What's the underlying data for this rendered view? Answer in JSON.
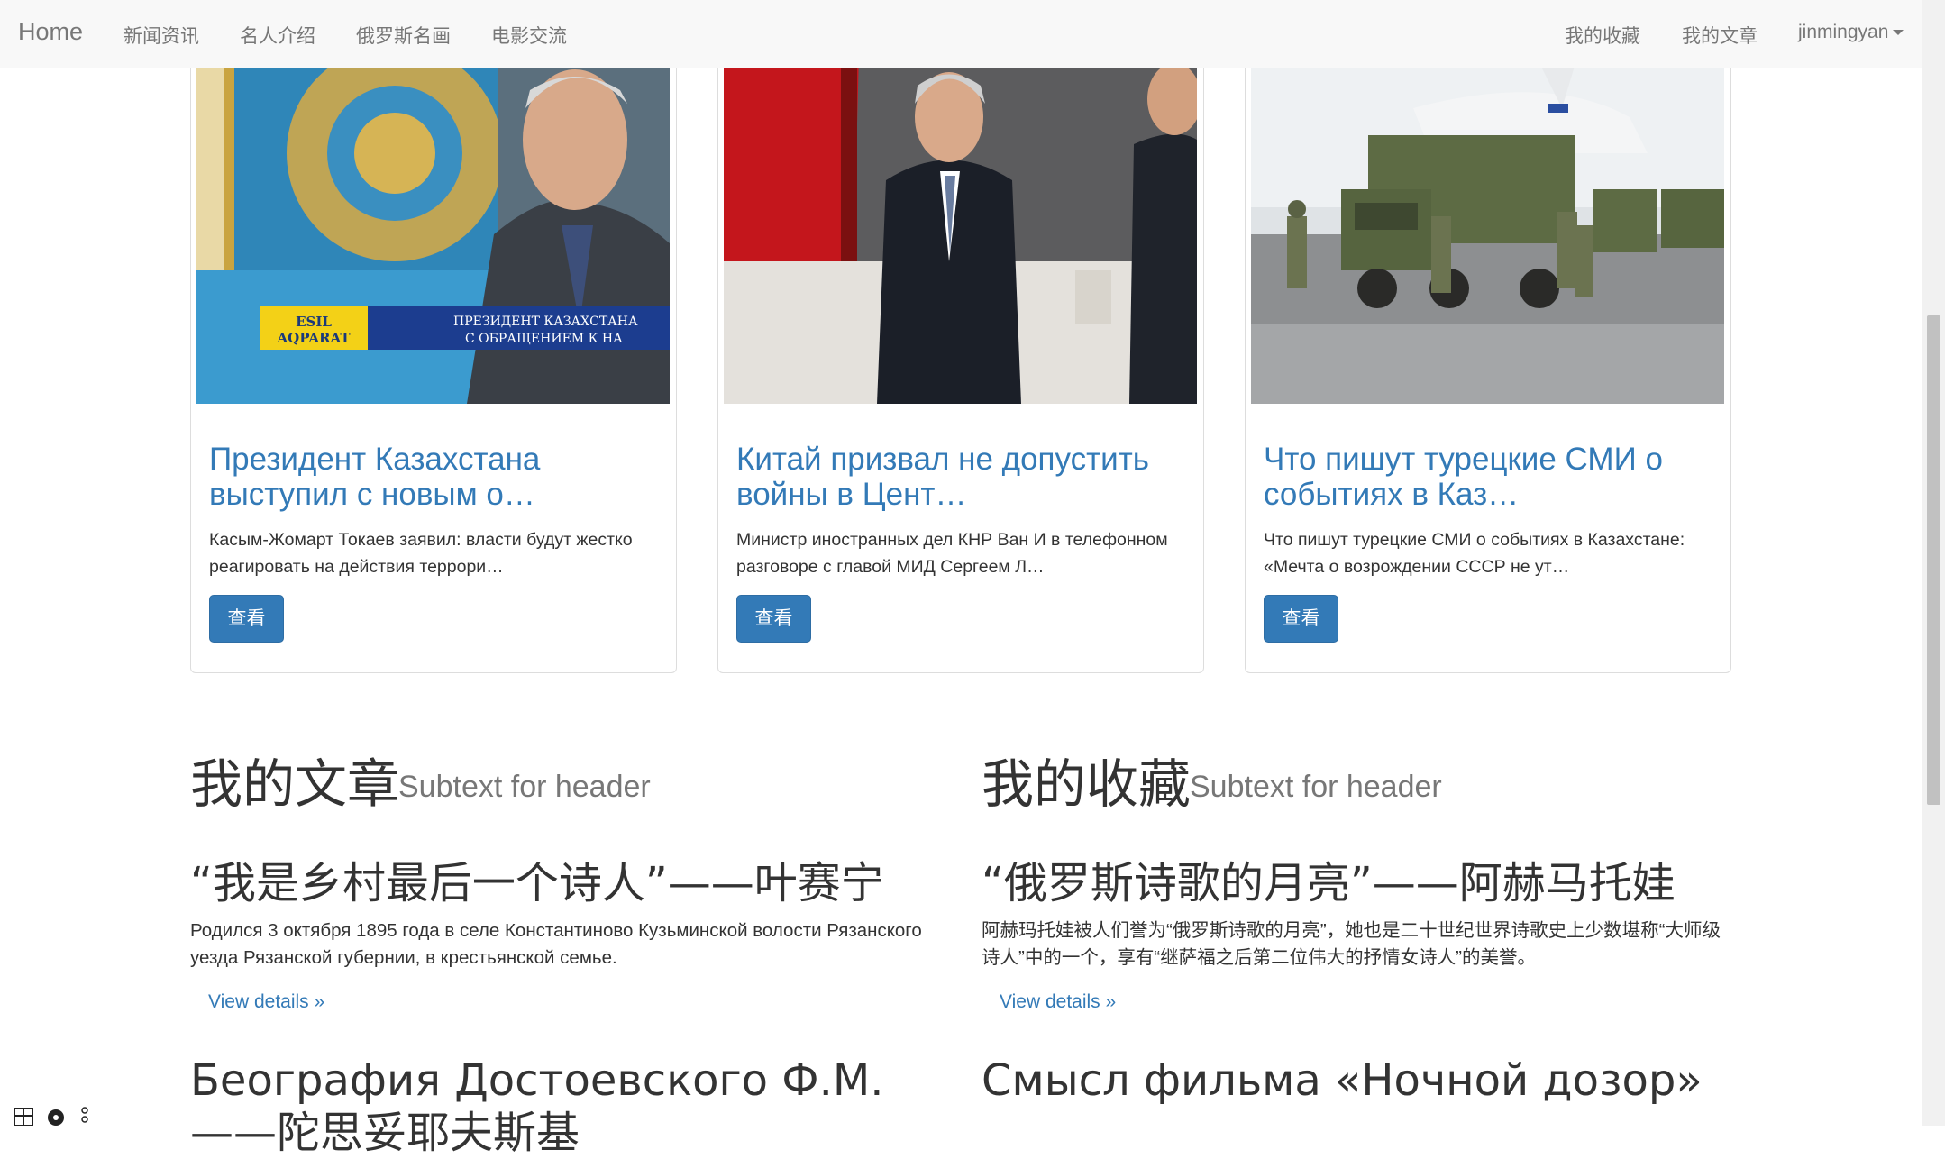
{
  "navbar": {
    "brand": "Home",
    "left_items": [
      "新闻资讯",
      "名人介绍",
      "俄罗斯名画",
      "电影交流"
    ],
    "right_items": [
      "我的收藏",
      "我的文章"
    ],
    "user": "jinmingyan"
  },
  "news_cards": [
    {
      "image": "kazakhstan-president-photo",
      "image_caption_logo": [
        "ESIL",
        "AQPARAT"
      ],
      "image_caption_ticker": [
        "ПРЕЗИДЕНТ КАЗАХСТАНА",
        "С ОБРАЩЕНИЕМ К НА"
      ],
      "title": "Президент Казахстана выступил с новым о…",
      "text": "Касым-Жомарт Токаев заявил: власти будут жестко реагировать на действия террори…",
      "button": "查看"
    },
    {
      "image": "wang-yi-photo",
      "title": "Китай призвал не допустить войны в Цент…",
      "text": "Министр иностранных дел КНР Ван И в телефонном разговоре с главой МИД Сергеем Л…",
      "button": "查看"
    },
    {
      "image": "military-trucks-photo",
      "title": "Что пишут турецкие СМИ о событиях в Каз…",
      "text": "Что пишут турецкие СМИ о событиях в Казахстане: «Мечта о возрождении СССР не ут…",
      "button": "查看"
    }
  ],
  "my_articles": {
    "header": "我的文章",
    "subtext": "Subtext for header",
    "items": [
      {
        "title": "“我是乡村最后一个诗人”——叶赛宁",
        "text": "Родился 3 октября 1895 года в селе Константиново Кузьминской волости Рязанского уезда Рязанской губернии, в крестьянской семье.",
        "link": "View details »"
      },
      {
        "title": "Беография Достоевского Ф.М. ——陀思妥耶夫斯基"
      }
    ]
  },
  "my_favorites": {
    "header": "我的收藏",
    "subtext": "Subtext for header",
    "items": [
      {
        "title": "“俄罗斯诗歌的月亮”——阿赫马托娃",
        "text": "阿赫玛托娃被人们誉为“俄罗斯诗歌的月亮”，她也是二十世纪世界诗歌史上少数堪称“大师级诗人”中的一个，享有“继萨福之后第二位伟大的抒情女诗人”的美誉。",
        "link": "View details »"
      },
      {
        "title": "Смысл фильма «Ночной дозор»"
      }
    ]
  },
  "colors": {
    "link": "#337ab7",
    "primary_button": "#337ab7",
    "navbar_bg": "#f8f8f8",
    "muted": "#777777"
  }
}
